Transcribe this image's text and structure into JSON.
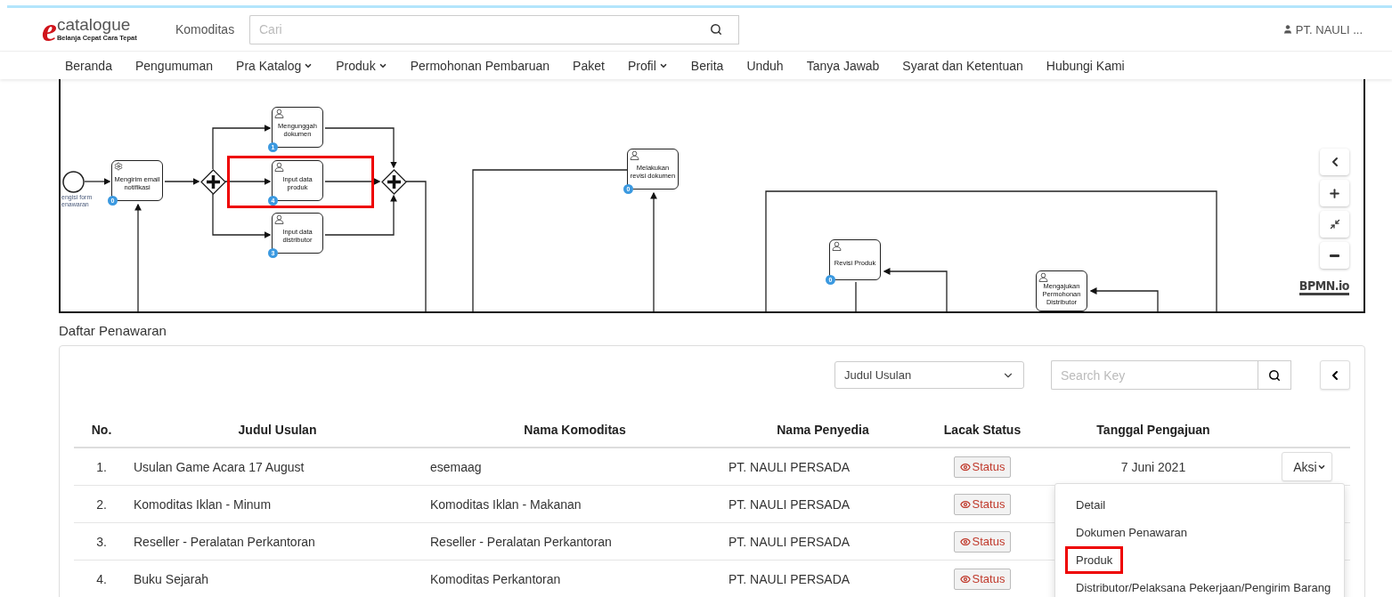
{
  "header": {
    "logo": {
      "mark": "e",
      "name": "catalogue",
      "tagline": "Belanja Cepat Cara Tepat"
    },
    "commodity_link": "Komoditas",
    "search": {
      "placeholder": "Cari"
    },
    "user": "PT. NAULI ..."
  },
  "nav": [
    {
      "label": "Beranda",
      "has_caret": false
    },
    {
      "label": "Pengumuman",
      "has_caret": false
    },
    {
      "label": "Pra Katalog",
      "has_caret": true
    },
    {
      "label": "Produk",
      "has_caret": true
    },
    {
      "label": "Permohonan Pembaruan",
      "has_caret": false
    },
    {
      "label": "Paket",
      "has_caret": false
    },
    {
      "label": "Profil",
      "has_caret": true
    },
    {
      "label": "Berita",
      "has_caret": false
    },
    {
      "label": "Unduh",
      "has_caret": false
    },
    {
      "label": "Tanya Jawab",
      "has_caret": false
    },
    {
      "label": "Syarat dan Ketentuan",
      "has_caret": false
    },
    {
      "label": "Hubungi Kami",
      "has_caret": false
    }
  ],
  "diagram": {
    "nodes": [
      {
        "kind": "start_event",
        "label": "engisi form enawaran"
      },
      {
        "kind": "service_task",
        "label": "Mengirim email notifikasi",
        "count": "0",
        "highlighted": false
      },
      {
        "kind": "gateway"
      },
      {
        "kind": "user_task",
        "label": "Mengunggah dokumen",
        "count": "1",
        "highlighted": false
      },
      {
        "kind": "user_task",
        "label": "Input data produk",
        "count": "4",
        "highlighted": true
      },
      {
        "kind": "user_task",
        "label": "Input data distributor",
        "count": "3",
        "highlighted": false
      },
      {
        "kind": "gateway"
      },
      {
        "kind": "user_task",
        "label": "Melakukan revisi dokumen",
        "count": "0",
        "highlighted": false
      },
      {
        "kind": "user_task",
        "label": "Revisi Produk",
        "count": "0",
        "highlighted": false
      },
      {
        "kind": "user_task",
        "label": "Mengajukan Permohonan Distributor",
        "highlighted": false
      }
    ],
    "watermark": "BPMN.io"
  },
  "section_title": "Daftar Penawaran",
  "filter": {
    "select": "Judul Usulan",
    "search": {
      "placeholder": "Search Key"
    }
  },
  "table": {
    "columns": [
      "No.",
      "Judul Usulan",
      "Nama Komoditas",
      "Nama Penyedia",
      "Lacak Status",
      "Tanggal Pengajuan"
    ],
    "rows": [
      {
        "no": "1.",
        "title": "Usulan Game Acara 17 August",
        "commodity": "esemaag",
        "provider": "PT. NAULI PERSADA",
        "status": "Status",
        "date": "7 Juni 2021",
        "action": "Aksi"
      },
      {
        "no": "2.",
        "title": "Komoditas Iklan - Minum",
        "commodity": "Komoditas Iklan - Makanan",
        "provider": "PT. NAULI PERSADA",
        "status": "Status"
      },
      {
        "no": "3.",
        "title": "Reseller - Peralatan Perkantoran",
        "commodity": "Reseller - Peralatan Perkantoran",
        "provider": "PT. NAULI PERSADA",
        "status": "Status"
      },
      {
        "no": "4.",
        "title": "Buku Sejarah",
        "commodity": "Komoditas Perkantoran",
        "provider": "PT. NAULI PERSADA",
        "status": "Status"
      }
    ]
  },
  "action_menu": [
    {
      "label": "Detail",
      "highlighted": false
    },
    {
      "label": "Dokumen Penawaran",
      "highlighted": false
    },
    {
      "label": "Produk",
      "highlighted": true
    },
    {
      "label": "Distributor/Pelaksana Pekerjaan/Pengirim Barang",
      "highlighted": false
    }
  ]
}
